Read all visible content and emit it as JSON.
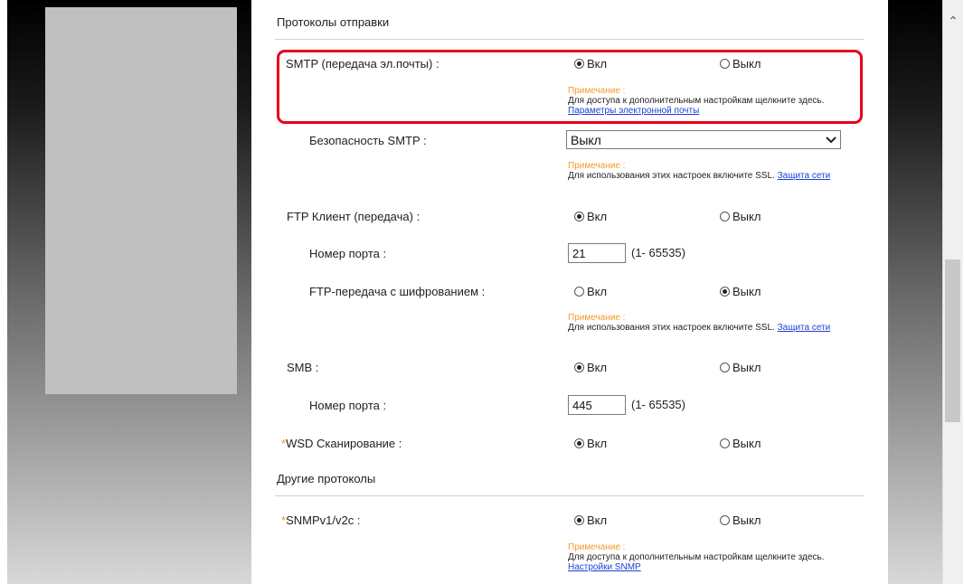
{
  "sections": {
    "send_protocols": "Протоколы отправки",
    "other_protocols": "Другие протоколы"
  },
  "options": {
    "on": "Вкл",
    "off": "Выкл"
  },
  "note_title": "Примечание :",
  "smtp": {
    "label": "SMTP (передача эл.почты) :",
    "selected": "on",
    "note_text": "Для доступа к дополнительным настройкам щелкните здесь.",
    "note_link": "Параметры электронной почты"
  },
  "smtp_security": {
    "label": "Безопасность SMTP :",
    "value": "Выкл",
    "note_text": "Для использования этих настроек включите SSL.",
    "note_link": "Защита сети"
  },
  "ftp_client": {
    "label": "FTP Клиент (передача) :",
    "selected": "on",
    "port_label": "Номер порта :",
    "port": "21",
    "port_range": "(1- 65535)"
  },
  "ftp_encrypted": {
    "label": "FTP-передача с шифрованием :",
    "selected": "off",
    "note_text": "Для использования этих настроек включите SSL.",
    "note_link": "Защита сети"
  },
  "smb": {
    "label": "SMB :",
    "selected": "on",
    "port_label": "Номер порта :",
    "port": "445",
    "port_range": "(1- 65535)"
  },
  "wsd": {
    "star": "*",
    "label": "WSD Сканирование :",
    "selected": "on"
  },
  "snmp": {
    "star": "*",
    "label": "SNMPv1/v2c :",
    "selected": "on",
    "note_text": "Для доступа к дополнительным настройкам щелкните здесь.",
    "note_link": "Настройки SNMP"
  },
  "colors": {
    "highlight": "#e8001c",
    "note_title": "#f39a2f",
    "link": "#1a3fd6"
  }
}
